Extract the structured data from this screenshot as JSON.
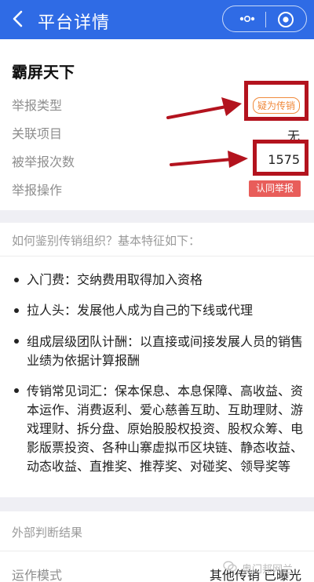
{
  "nav": {
    "title": "平台详情",
    "back_icon": "chevron-left-icon",
    "more_icon": "more-dots-icon",
    "close_icon": "close-circle-icon",
    "background": "#2f6be5"
  },
  "platform": {
    "name": "霸屏天下",
    "rows": [
      {
        "label": "举报类型",
        "value": "疑为传销"
      },
      {
        "label": "关联项目",
        "value": "无"
      },
      {
        "label": "被举报次数",
        "value": "1575"
      },
      {
        "label": "举报操作",
        "value": "认同举报"
      }
    ]
  },
  "guide": {
    "title": "如何鉴别传销组织？基本特征如下：",
    "items": [
      "入门费：交纳费用取得加入资格",
      "拉人头：发展他人成为自己的下线或代理",
      "组成层级团队计酬：以直接或间接发展人员的销售业绩为依据计算报酬",
      "传销常见词汇：保本保息、本息保障、高收益、资本运作、消费返利、爱心慈善互助、互助理财、游戏理财、拆分盘、原始股股权投资、股权众筹、电影版票投资、各种山寨虚拟币区块链、静态收益、动态收益、直推奖、推荐奖、对碰奖、领导奖等"
    ]
  },
  "external": {
    "title": "外部判断结果",
    "label": "运作模式",
    "value": "其他传销 已曝光"
  },
  "watermark": "奥门邦网兰",
  "colors": {
    "annotation_red": "#b3131e",
    "tag_orange": "#f08a3c",
    "button_red": "#e85d5a"
  }
}
